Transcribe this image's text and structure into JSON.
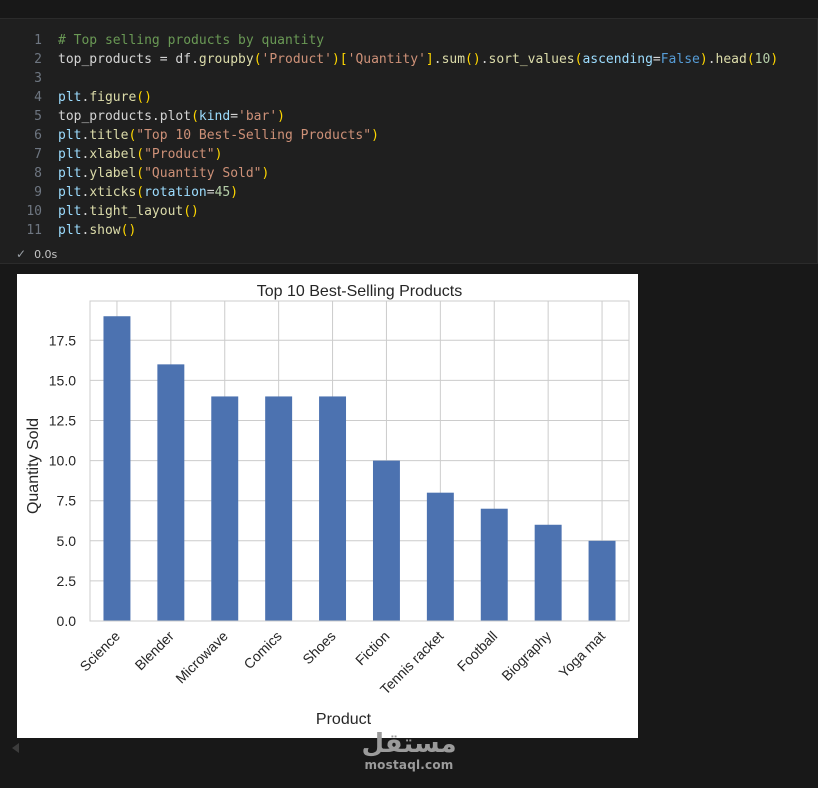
{
  "code": {
    "lines": [
      {
        "n": "1",
        "tokens": [
          {
            "t": "# Top selling products by quantity",
            "c": "c-com"
          }
        ]
      },
      {
        "n": "2",
        "tokens": [
          {
            "t": "top_products",
            "c": "c-pl"
          },
          {
            "t": " = ",
            "c": "c-pl"
          },
          {
            "t": "df",
            "c": "c-pl"
          },
          {
            "t": ".",
            "c": "c-pl"
          },
          {
            "t": "groupby",
            "c": "c-fn"
          },
          {
            "t": "(",
            "c": "c-p1"
          },
          {
            "t": "'Product'",
            "c": "c-str"
          },
          {
            "t": ")",
            "c": "c-p1"
          },
          {
            "t": "[",
            "c": "c-p1"
          },
          {
            "t": "'Quantity'",
            "c": "c-str"
          },
          {
            "t": "]",
            "c": "c-p1"
          },
          {
            "t": ".",
            "c": "c-pl"
          },
          {
            "t": "sum",
            "c": "c-fn"
          },
          {
            "t": "()",
            "c": "c-p1"
          },
          {
            "t": ".",
            "c": "c-pl"
          },
          {
            "t": "sort_values",
            "c": "c-fn"
          },
          {
            "t": "(",
            "c": "c-p1"
          },
          {
            "t": "ascending",
            "c": "c-var"
          },
          {
            "t": "=",
            "c": "c-pl"
          },
          {
            "t": "False",
            "c": "c-kw"
          },
          {
            "t": ")",
            "c": "c-p1"
          },
          {
            "t": ".",
            "c": "c-pl"
          },
          {
            "t": "head",
            "c": "c-fn"
          },
          {
            "t": "(",
            "c": "c-p1"
          },
          {
            "t": "10",
            "c": "c-num"
          },
          {
            "t": ")",
            "c": "c-p1"
          }
        ]
      },
      {
        "n": "3",
        "tokens": []
      },
      {
        "n": "4",
        "tokens": [
          {
            "t": "plt",
            "c": "c-var"
          },
          {
            "t": ".",
            "c": "c-pl"
          },
          {
            "t": "figure",
            "c": "c-fn"
          },
          {
            "t": "()",
            "c": "c-p1"
          }
        ]
      },
      {
        "n": "5",
        "tokens": [
          {
            "t": "top_products",
            "c": "c-pl"
          },
          {
            "t": ".",
            "c": "c-pl"
          },
          {
            "t": "plot",
            "c": "c-pl"
          },
          {
            "t": "(",
            "c": "c-p1"
          },
          {
            "t": "kind",
            "c": "c-var"
          },
          {
            "t": "=",
            "c": "c-pl"
          },
          {
            "t": "'bar'",
            "c": "c-str"
          },
          {
            "t": ")",
            "c": "c-p1"
          }
        ]
      },
      {
        "n": "6",
        "tokens": [
          {
            "t": "plt",
            "c": "c-var"
          },
          {
            "t": ".",
            "c": "c-pl"
          },
          {
            "t": "title",
            "c": "c-fn"
          },
          {
            "t": "(",
            "c": "c-p1"
          },
          {
            "t": "\"Top 10 Best-Selling Products\"",
            "c": "c-str"
          },
          {
            "t": ")",
            "c": "c-p1"
          }
        ]
      },
      {
        "n": "7",
        "tokens": [
          {
            "t": "plt",
            "c": "c-var"
          },
          {
            "t": ".",
            "c": "c-pl"
          },
          {
            "t": "xlabel",
            "c": "c-fn"
          },
          {
            "t": "(",
            "c": "c-p1"
          },
          {
            "t": "\"Product\"",
            "c": "c-str"
          },
          {
            "t": ")",
            "c": "c-p1"
          }
        ]
      },
      {
        "n": "8",
        "tokens": [
          {
            "t": "plt",
            "c": "c-var"
          },
          {
            "t": ".",
            "c": "c-pl"
          },
          {
            "t": "ylabel",
            "c": "c-fn"
          },
          {
            "t": "(",
            "c": "c-p1"
          },
          {
            "t": "\"Quantity Sold\"",
            "c": "c-str"
          },
          {
            "t": ")",
            "c": "c-p1"
          }
        ]
      },
      {
        "n": "9",
        "tokens": [
          {
            "t": "plt",
            "c": "c-var"
          },
          {
            "t": ".",
            "c": "c-pl"
          },
          {
            "t": "xticks",
            "c": "c-fn"
          },
          {
            "t": "(",
            "c": "c-p1"
          },
          {
            "t": "rotation",
            "c": "c-var"
          },
          {
            "t": "=",
            "c": "c-pl"
          },
          {
            "t": "45",
            "c": "c-num"
          },
          {
            "t": ")",
            "c": "c-p1"
          }
        ]
      },
      {
        "n": "10",
        "tokens": [
          {
            "t": "plt",
            "c": "c-var"
          },
          {
            "t": ".",
            "c": "c-pl"
          },
          {
            "t": "tight_layout",
            "c": "c-fn"
          },
          {
            "t": "()",
            "c": "c-p1"
          }
        ]
      },
      {
        "n": "11",
        "tokens": [
          {
            "t": "plt",
            "c": "c-var"
          },
          {
            "t": ".",
            "c": "c-pl"
          },
          {
            "t": "show",
            "c": "c-fn"
          },
          {
            "t": "()",
            "c": "c-p1"
          }
        ]
      }
    ]
  },
  "status": {
    "icon": "check-icon",
    "time": "0.0s"
  },
  "chart_data": {
    "type": "bar",
    "title": "Top 10 Best-Selling Products",
    "xlabel": "Product",
    "ylabel": "Quantity Sold",
    "categories": [
      "Science",
      "Blender",
      "Microwave",
      "Comics",
      "Shoes",
      "Fiction",
      "Tennis racket",
      "Football",
      "Biography",
      "Yoga mat"
    ],
    "values": [
      19,
      16,
      14,
      14,
      14,
      10,
      8,
      7,
      6,
      5
    ],
    "yticks": [
      "0.0",
      "2.5",
      "5.0",
      "7.5",
      "10.0",
      "12.5",
      "15.0",
      "17.5"
    ],
    "ylim": [
      0,
      19.95
    ],
    "grid": true,
    "bar_color": "#4c72b0"
  },
  "watermark": {
    "arabic": "مستقل",
    "latin": "mostaql.com"
  }
}
